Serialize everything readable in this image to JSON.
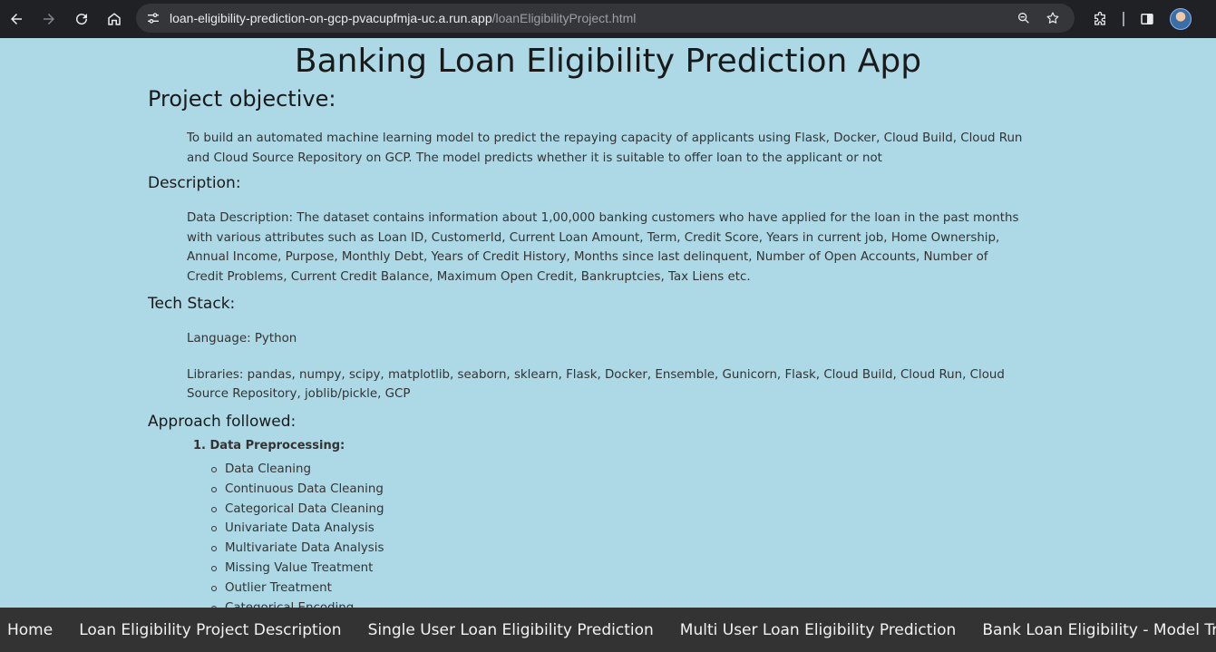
{
  "browser": {
    "url_host": "loan-eligibility-prediction-on-gcp-pvacupfmja-uc.a.run.app",
    "url_path": "/loanEligibilityProject.html"
  },
  "page": {
    "title": "Banking Loan Eligibility Prediction App",
    "objective": {
      "heading": "Project objective:",
      "text": "To build an automated machine learning model to predict the repaying capacity of applicants using Flask, Docker, Cloud Build, Cloud Run and Cloud Source Repository on GCP. The model predicts whether it is suitable to offer loan to the applicant or not"
    },
    "description": {
      "heading": "Description:",
      "text": "Data Description: The dataset contains information about 1,00,000 banking customers who have applied for the loan in the past months with various attributes such as Loan ID, CustomerId, Current Loan Amount, Term, Credit Score, Years in current job, Home Ownership, Annual Income, Purpose, Monthly Debt, Years of Credit History, Months since last delinquent, Number of Open Accounts, Number of Credit Problems, Current Credit Balance, Maximum Open Credit, Bankruptcies, Tax Liens etc."
    },
    "tech_stack": {
      "heading": "Tech Stack:",
      "language": "Language: Python",
      "libraries": "Libraries: pandas, numpy, scipy, matplotlib, seaborn, sklearn, Flask, Docker, Ensemble, Gunicorn, Flask, Cloud Build, Cloud Run, Cloud Source Repository, joblib/pickle, GCP"
    },
    "approach": {
      "heading": "Approach followed:",
      "step1": "1. Data Preprocessing:",
      "items": [
        "Data Cleaning",
        "Continuous Data Cleaning",
        "Categorical Data Cleaning",
        "Univariate Data Analysis",
        "Multivariate Data Analysis",
        "Missing Value Treatment",
        "Outlier Treatment",
        "Categorical Encoding"
      ]
    }
  },
  "bottom_nav": [
    "Home",
    "Loan Eligibility Project Description",
    "Single User Loan Eligibility Prediction",
    "Multi User Loan Eligibility Prediction",
    "Bank Loan Eligibility - Model Training"
  ]
}
